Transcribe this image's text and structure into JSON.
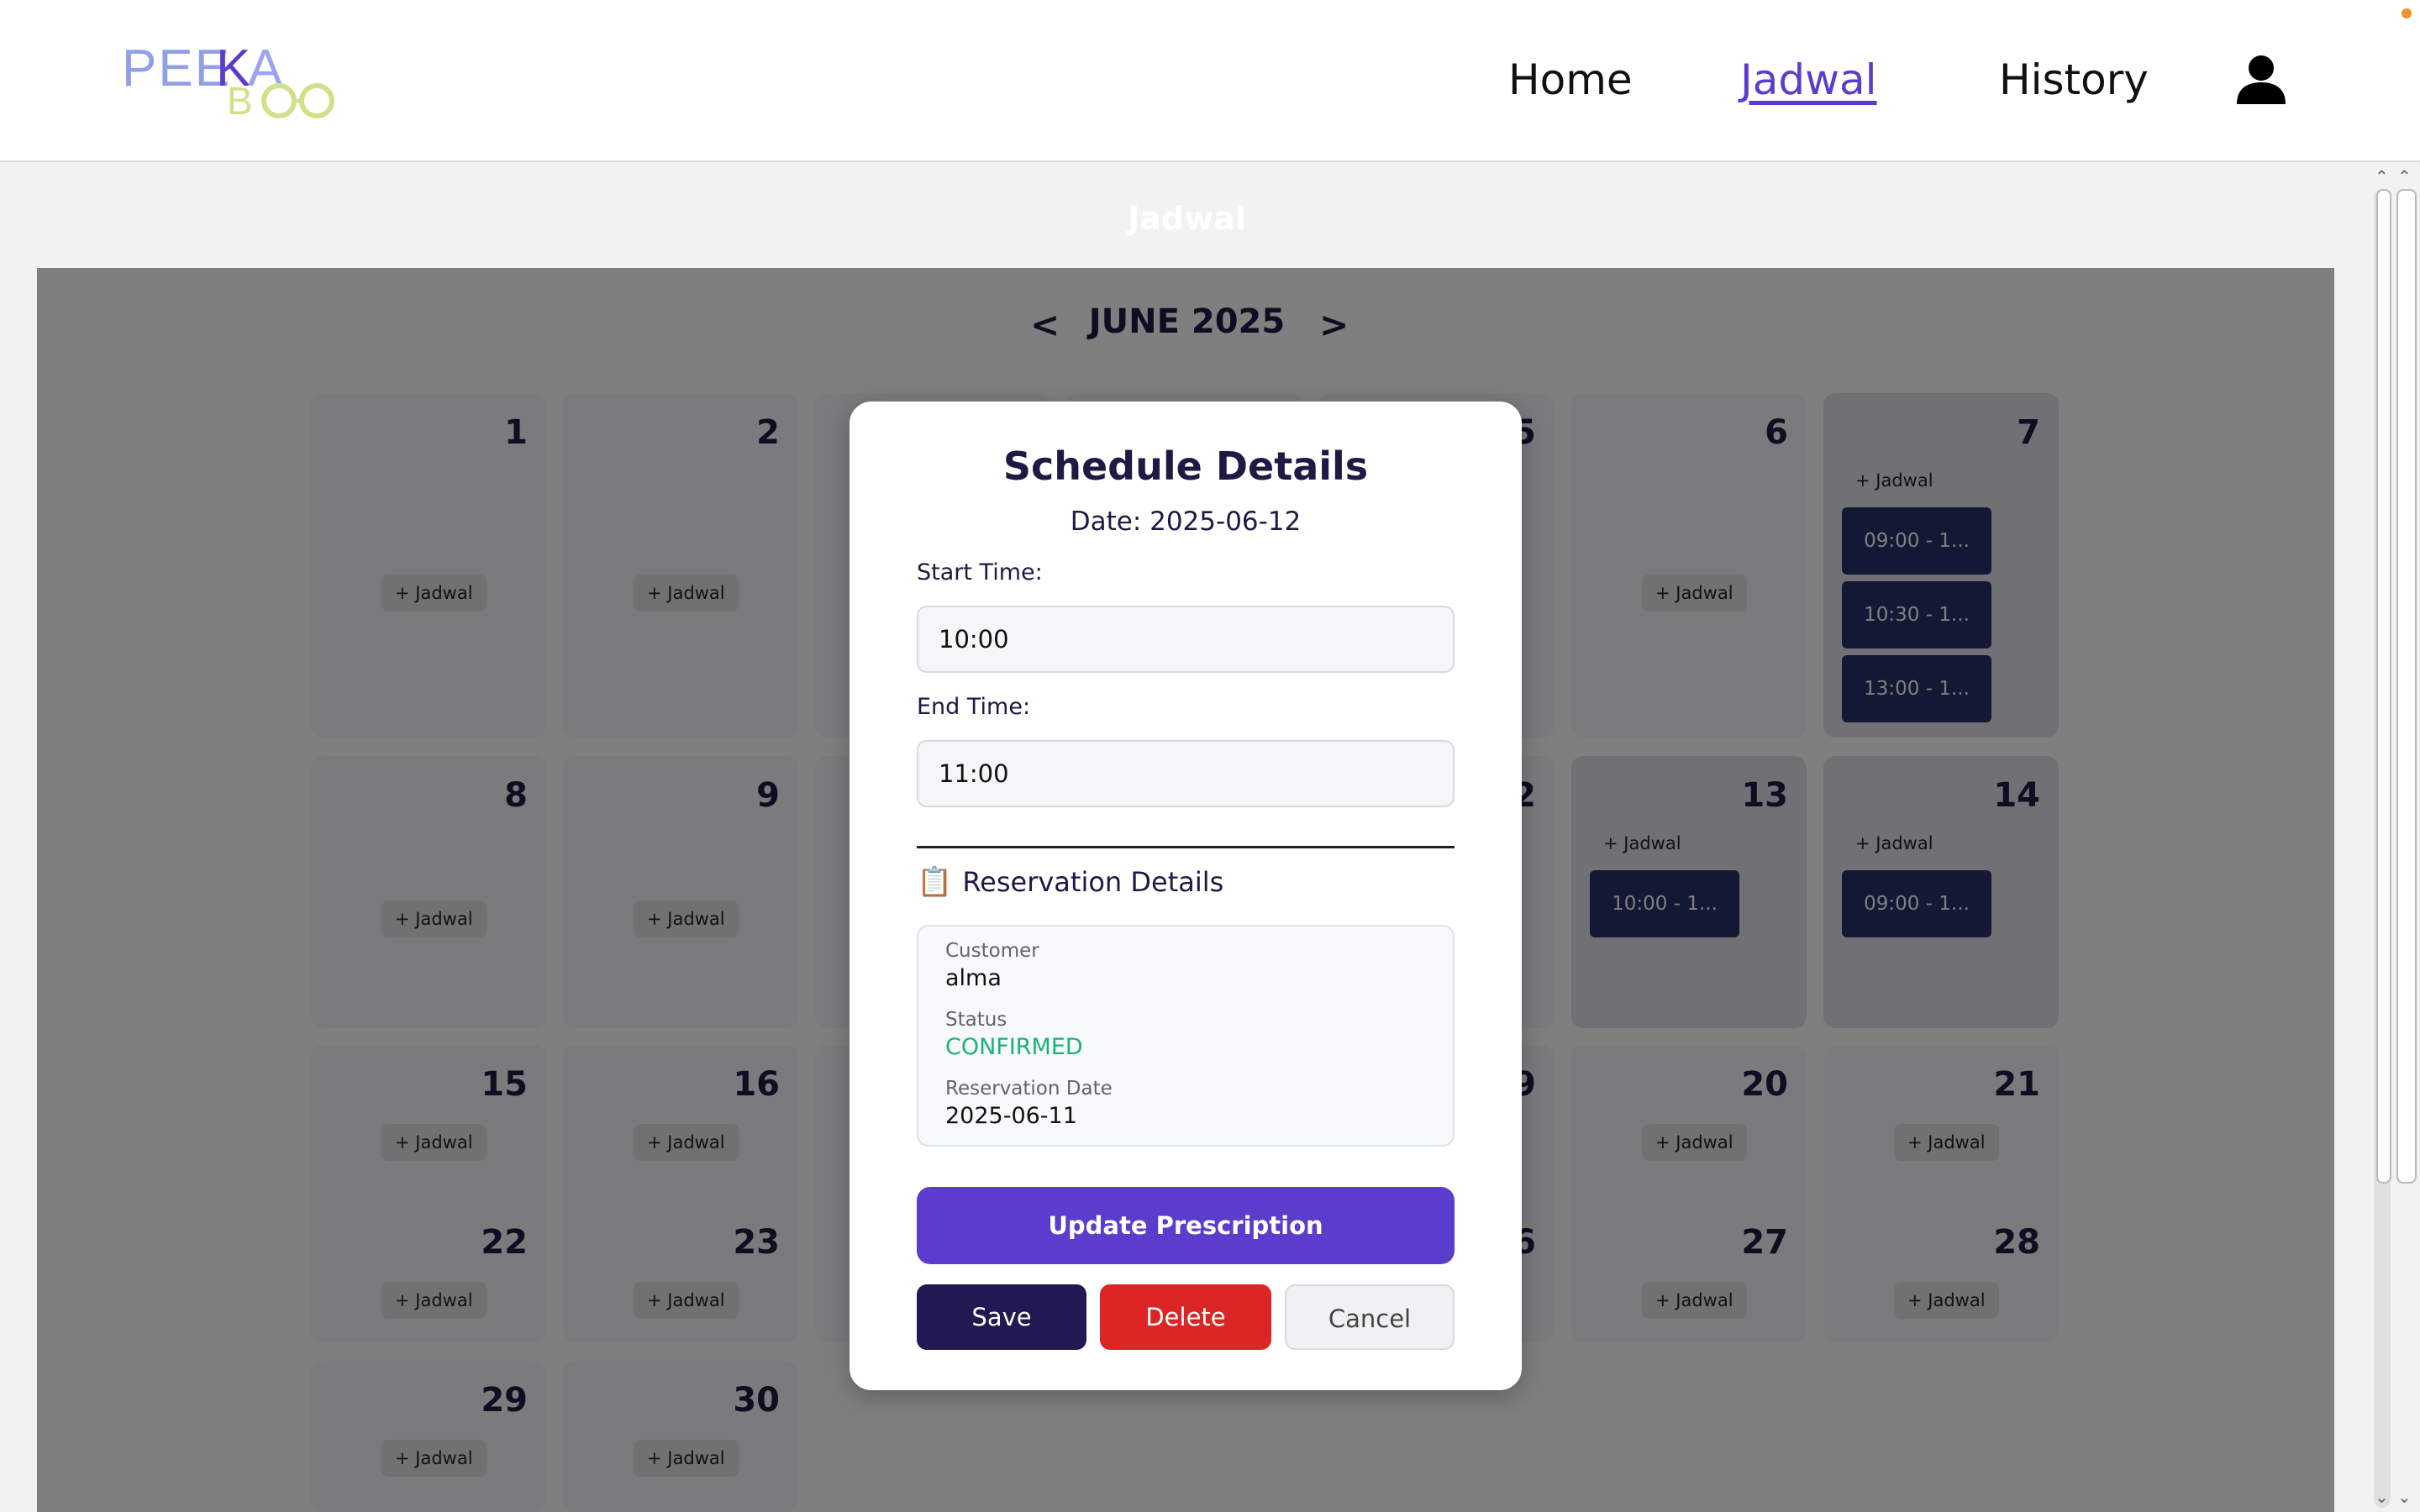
{
  "navbar": {
    "logo_top": "PEEKA",
    "logo_bottom": "BOO",
    "links": [
      "Home",
      "Jadwal",
      "History"
    ],
    "active_link": "Jadwal"
  },
  "page": {
    "title": "Jadwal"
  },
  "calendar": {
    "month_label": "JUNE 2025",
    "prev_label": "<",
    "next_label": ">",
    "add_label": "+ Jadwal",
    "days": [
      {
        "day": "1",
        "slots": []
      },
      {
        "day": "2",
        "slots": []
      },
      {
        "day": "6",
        "slots": []
      },
      {
        "day": "7",
        "slots": [
          "09:00 - 1...",
          "10:30 - 1...",
          "13:00 - 1..."
        ]
      },
      {
        "day": "8",
        "slots": []
      },
      {
        "day": "9",
        "slots": []
      },
      {
        "day": "13",
        "slots": [
          "10:00 - 1..."
        ]
      },
      {
        "day": "14",
        "slots": [
          "09:00 - 1..."
        ]
      },
      {
        "day": "15",
        "slots": []
      },
      {
        "day": "16",
        "slots": []
      },
      {
        "day": "20",
        "slots": []
      },
      {
        "day": "21",
        "slots": []
      },
      {
        "day": "22",
        "slots": []
      },
      {
        "day": "23",
        "slots": []
      },
      {
        "day": "27",
        "slots": []
      },
      {
        "day": "28",
        "slots": []
      },
      {
        "day": "29",
        "slots": []
      },
      {
        "day": "30",
        "slots": []
      }
    ],
    "partial_day_digits": [
      "5",
      "2",
      "9",
      "6"
    ]
  },
  "modal": {
    "title": "Schedule Details",
    "date_line": "Date: 2025-06-12",
    "start_label": "Start Time:",
    "start_value": "10:00",
    "end_label": "End Time:",
    "end_value": "11:00",
    "reservation_heading": "Reservation Details",
    "reservation_icon": "clipboard-icon",
    "customer_label": "Customer",
    "customer_value": "alma",
    "status_label": "Status",
    "status_value": "CONFIRMED",
    "reservation_date_label": "Reservation Date",
    "reservation_date_value": "2025-06-11",
    "update_button": "Update Prescription",
    "save_button": "Save",
    "delete_button": "Delete",
    "cancel_button": "Cancel"
  },
  "colors": {
    "accent": "#5b3ccd",
    "dark_navy": "#1d1a44",
    "slot": "#27336b",
    "delete": "#dc2626",
    "confirmed": "#1bb27a"
  }
}
